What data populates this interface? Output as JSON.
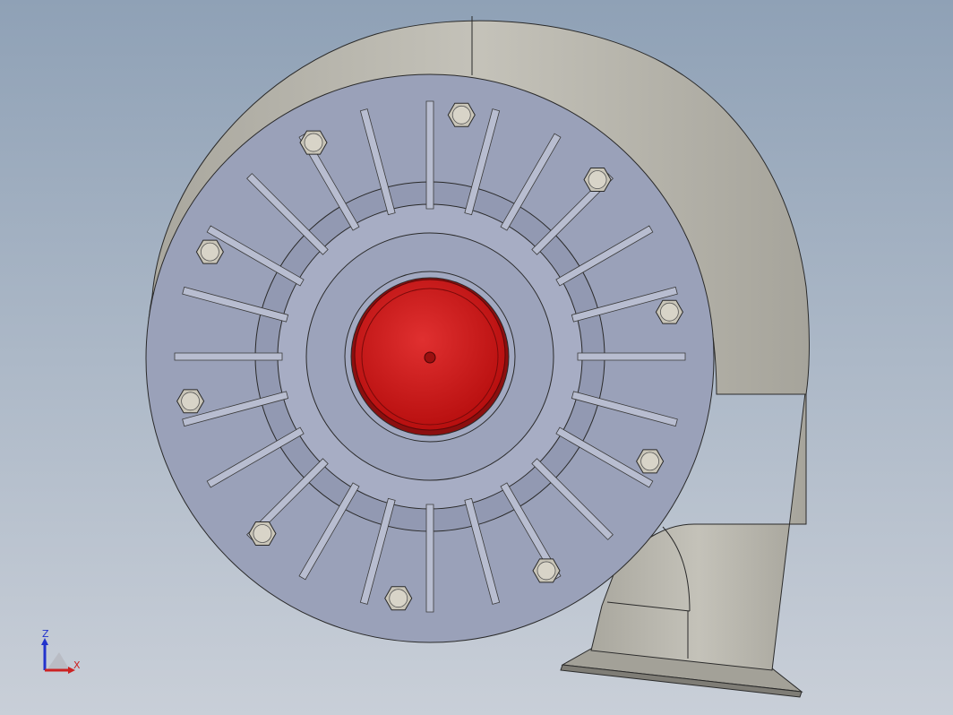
{
  "viewport": {
    "background_top": "#8fa1b6",
    "background_bottom": "#c9cfd8",
    "model": {
      "name": "centrifugal-fan-housing",
      "colors": {
        "volute": "#b0aea5",
        "volute_shadow": "#8f8d85",
        "faceplate": "#9da3ba",
        "faceplate_dark": "#8a91aa",
        "hub": "#c81414",
        "hub_highlight": "#e23333",
        "bolt": "#d8d4c8",
        "edge": "#2a2a2a"
      },
      "blade_count": 24,
      "bolt_count": 10
    }
  },
  "triad": {
    "z_label": "Z",
    "x_label": "X",
    "z_color": "#2233cc",
    "x_color": "#cc2222"
  }
}
